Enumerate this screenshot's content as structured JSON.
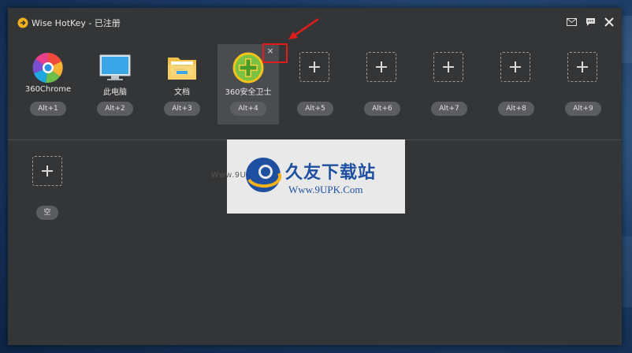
{
  "window": {
    "title": "Wise HotKey - 已注册"
  },
  "colors": {
    "accent_red": "#e21c1c",
    "window_bg": "#333537",
    "key_pill": "#5b5d60"
  },
  "top_slots": [
    {
      "name": "360Chrome",
      "key": "Alt+1",
      "icon": "chrome-360-icon"
    },
    {
      "name": "此电脑",
      "key": "Alt+2",
      "icon": "monitor-icon"
    },
    {
      "name": "文档",
      "key": "Alt+3",
      "icon": "folder-icon"
    },
    {
      "name": "360安全卫士",
      "key": "Alt+4",
      "icon": "security-guard-icon"
    },
    {
      "name": "",
      "key": "Alt+5",
      "icon": "plus-icon"
    },
    {
      "name": "",
      "key": "Alt+6",
      "icon": "plus-icon"
    },
    {
      "name": "",
      "key": "Alt+7",
      "icon": "plus-icon"
    },
    {
      "name": "",
      "key": "Alt+8",
      "icon": "plus-icon"
    },
    {
      "name": "",
      "key": "Alt+9",
      "icon": "plus-icon"
    }
  ],
  "bottom_slot": {
    "key": "空"
  },
  "remove_symbol": "×",
  "watermark": {
    "brand": "久友下载站",
    "url": "Www.9UPK.Com",
    "site_left": "Www.9UPK.Com"
  }
}
